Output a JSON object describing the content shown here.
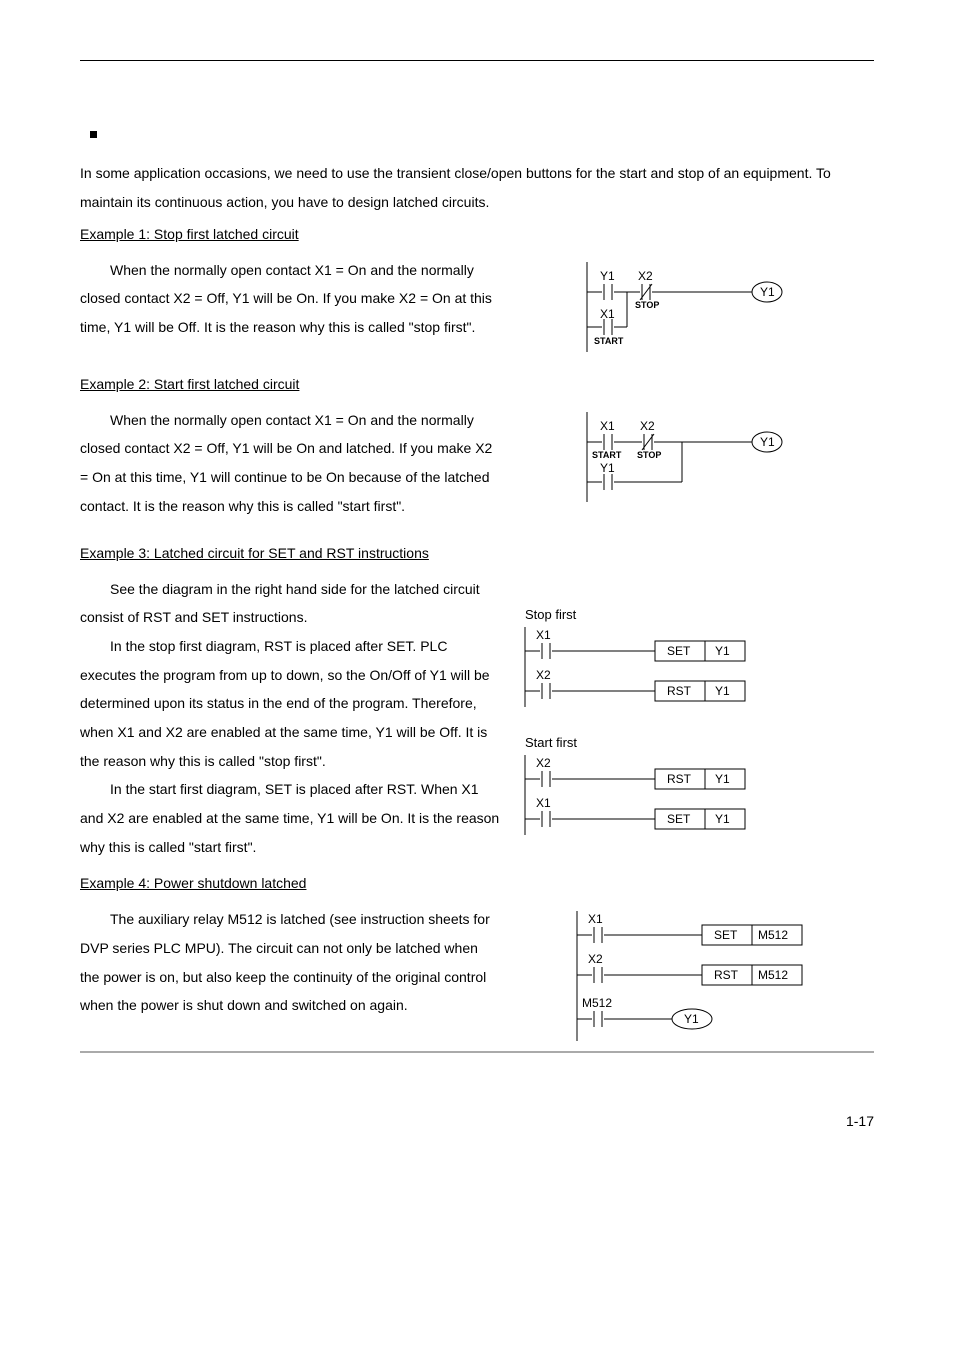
{
  "intro": "In some application occasions, we need to use the transient close/open buttons for the start and stop of an equipment. To maintain its continuous action, you have to design latched circuits.",
  "ex1": {
    "title": "Example 1: Stop first latched circuit",
    "body": "When the normally open contact X1 = On and the normally closed contact X2 = Off, Y1 will be On. If you make X2 = On at this time, Y1 will be Off. It is the reason why this is called \"stop first\".",
    "diag": {
      "Y1": "Y1",
      "X2": "X2",
      "X1": "X1",
      "STOP": "STOP",
      "START": "START",
      "out": "Y1"
    }
  },
  "ex2": {
    "title": "Example 2: Start first latched circuit",
    "body": "When the normally open contact X1 = On and the normally closed contact X2 = Off, Y1 will be On and latched. If you make X2 = On at this time, Y1 will continue to be On because of the latched contact. It is the reason why this is called \"start first\".",
    "diag": {
      "X1": "X1",
      "X2": "X2",
      "Y1": "Y1",
      "STOP": "STOP",
      "START": "START",
      "out": "Y1"
    }
  },
  "ex3": {
    "title": "Example 3: Latched circuit for SET and RST instructions",
    "p1": "See the diagram in the right hand side for the latched circuit consist of RST and SET instructions.",
    "p2": "In the stop first diagram, RST is placed after SET. PLC executes the program from up to down, so the On/Off of Y1 will be determined upon its status in the end of the program. Therefore, when X1 and X2 are enabled at the same time, Y1 will be Off. It is the reason why this is called \"stop first\".",
    "p3": "In the start first diagram, SET is placed after RST. When X1 and X2 are enabled at the same time, Y1 will be On. It is the reason why this is called \"start first\".",
    "diag": {
      "stopfirst": "Stop first",
      "startfirst": "Start first",
      "X1": "X1",
      "X2": "X2",
      "SET": "SET",
      "RST": "RST",
      "Y1": "Y1"
    }
  },
  "ex4": {
    "title": "Example 4: Power shutdown latched",
    "body": "The auxiliary relay M512 is latched (see instruction sheets for DVP series PLC MPU). The circuit can not only be latched when the power is on, but also keep the continuity of the original control when the power is shut down and switched on again.",
    "diag": {
      "X1": "X1",
      "X2": "X2",
      "M512": "M512",
      "SET": "SET",
      "RST": "RST",
      "Y1": "Y1"
    }
  },
  "pagenum": "1-17"
}
